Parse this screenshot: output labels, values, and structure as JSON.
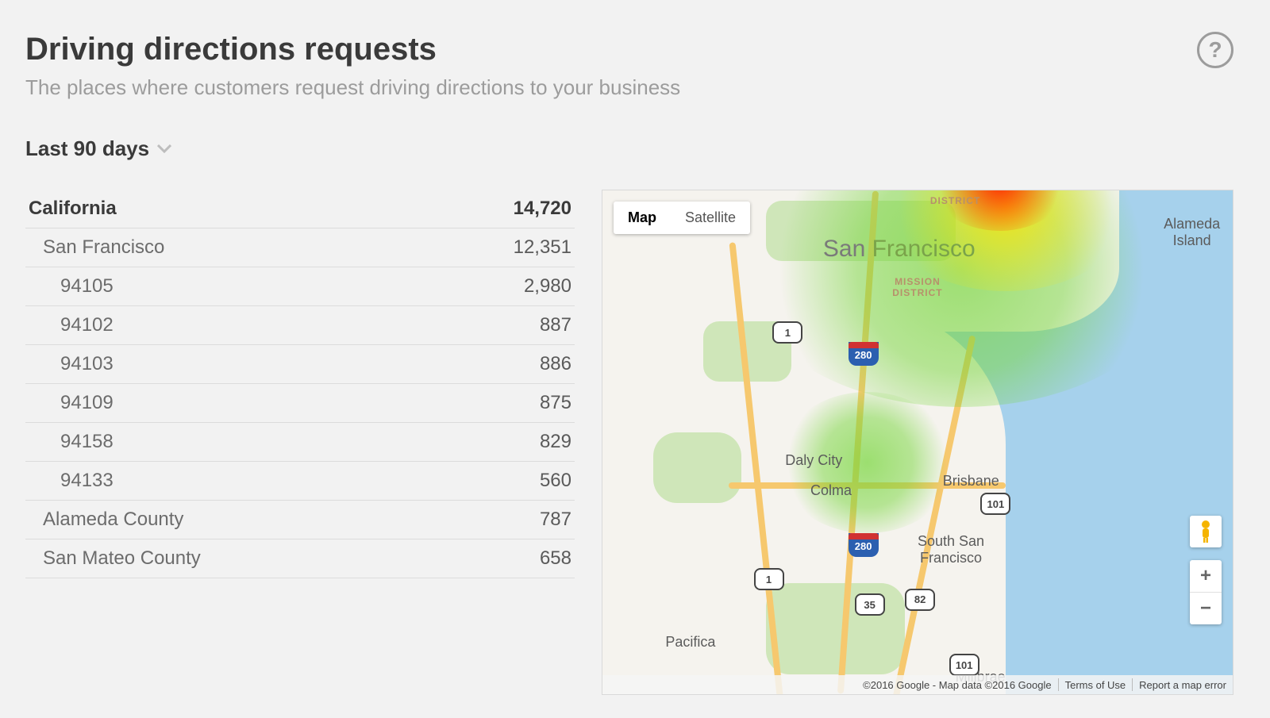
{
  "header": {
    "title": "Driving directions requests",
    "subtitle": "The places where customers request driving directions to your business"
  },
  "date_range": {
    "label": "Last 90 days"
  },
  "table": {
    "rows": [
      {
        "level": 0,
        "name": "California",
        "value": "14,720"
      },
      {
        "level": 1,
        "name": "San Francisco",
        "value": "12,351"
      },
      {
        "level": 2,
        "name": "94105",
        "value": "2,980"
      },
      {
        "level": 2,
        "name": "94102",
        "value": "887"
      },
      {
        "level": 2,
        "name": "94103",
        "value": "886"
      },
      {
        "level": 2,
        "name": "94109",
        "value": "875"
      },
      {
        "level": 2,
        "name": "94158",
        "value": "829"
      },
      {
        "level": 2,
        "name": "94133",
        "value": "560"
      },
      {
        "level": 1,
        "name": "Alameda County",
        "value": "787"
      },
      {
        "level": 1,
        "name": "San Mateo County",
        "value": "658"
      }
    ]
  },
  "map": {
    "type_buttons": {
      "map": "Map",
      "satellite": "Satellite",
      "active": "map"
    },
    "labels": {
      "sf_1": "San ",
      "sf_2": "Francisco",
      "district": "DISTRICT",
      "mission": "MISSION\nDISTRICT",
      "alameda": "Alameda\nIsland",
      "daly": "Daly City",
      "colma": "Colma",
      "brisbane": "Brisbane",
      "ssf": "South San\nFrancisco",
      "pacifica": "Pacifica",
      "millbrae": "Millbrae"
    },
    "shields": {
      "us1a": "1",
      "us1b": "1",
      "i280a": "280",
      "i280b": "280",
      "us101": "101",
      "us101b": "101",
      "ca82": "82",
      "ca35": "35"
    },
    "zoom": {
      "in": "+",
      "out": "−"
    },
    "attribution": {
      "left": "©2016 Google - Map data ©2016 Google",
      "terms": "Terms of Use",
      "report": "Report a map error"
    }
  }
}
